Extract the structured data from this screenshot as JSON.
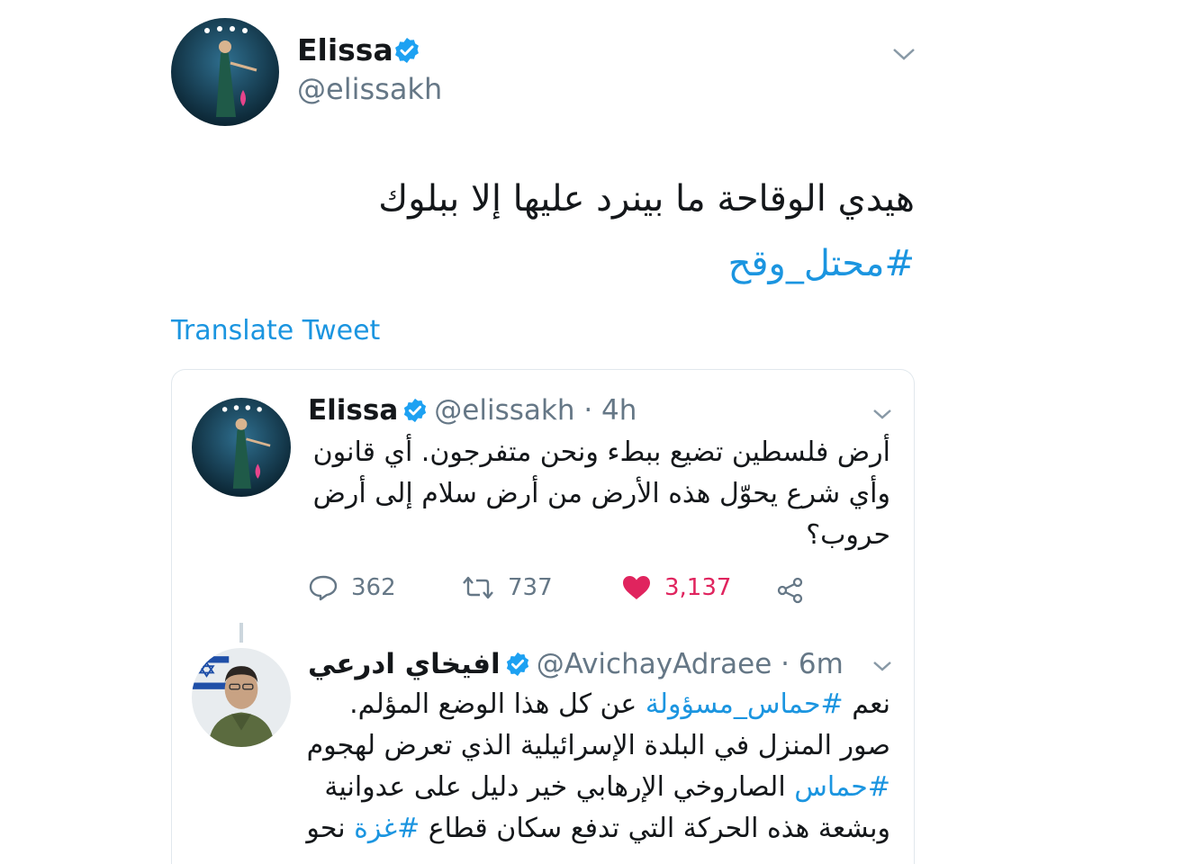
{
  "main_tweet": {
    "name": "Elissa",
    "handle": "@elissakh",
    "text": "هيدي الوقاحة ما بينرد عليها إلا ببلوك",
    "hashtag": "#محتل_وقح",
    "translate_label": "Translate Tweet"
  },
  "quoted_tweet": {
    "name": "Elissa",
    "meta": "@elissakh · 4h",
    "text": "أرض فلسطين تضيع ببطء ونحن متفرجون. أي قانون وأي شرع يحوّل هذه الأرض من أرض سلام إلى أرض حروب؟",
    "stats": {
      "replies": "362",
      "retweets": "737",
      "likes": "3,137"
    }
  },
  "reply_tweet": {
    "name": "افيخاي ادرعي",
    "meta": "@AvichayAdraee · 6m",
    "line1_a": "نعم ",
    "line1_tag": "#حماس_مسؤولة",
    "line1_b": " عن كل هذا الوضع المؤلم.",
    "line2": "صور المنزل في البلدة الإسرائيلية الذي تعرض لهجوم ",
    "line3_tag": "#حماس",
    "line3_b": " الصاروخي الإرهابي خير دليل على عدوانية",
    "line4_a": "وبشعة هذه الحركة التي تدفع سكان قطاع ",
    "line4_tag": "#غزة",
    "line4_b": " نحو"
  },
  "colors": {
    "link": "#1b95e0",
    "like": "#e0245e",
    "muted": "#657786"
  },
  "icons": [
    "verified-badge-icon",
    "chevron-down-icon",
    "reply-icon",
    "retweet-icon",
    "heart-icon",
    "share-icon"
  ]
}
